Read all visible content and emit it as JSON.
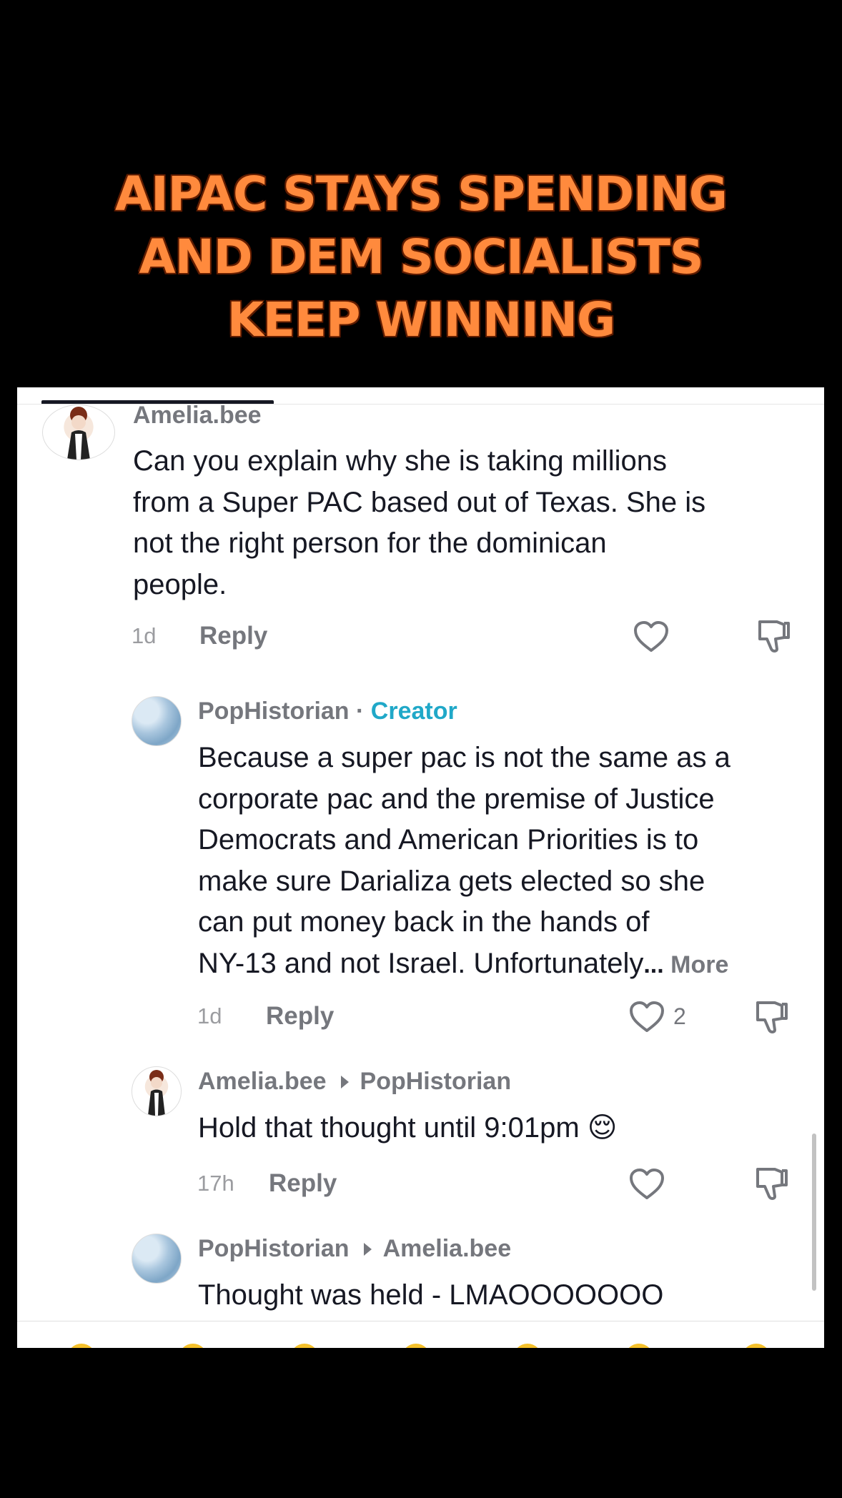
{
  "headline": {
    "line1": "AIPAC STAYS SPENDING",
    "line2": "AND DEM SOCIALISTS",
    "line3": "KEEP WINNING"
  },
  "comments": {
    "c1": {
      "username": "Amelia.bee",
      "lines": [
        "Can you explain why she is taking millions",
        "from a Super PAC based out of Texas. She is",
        "not the right person for the dominican",
        "people."
      ],
      "time": "1d",
      "reply": "Reply"
    },
    "c2": {
      "username": "PopHistorian",
      "separator": " · ",
      "badge": "Creator",
      "lines": [
        "Because a super pac is not the same as a",
        "corporate pac and the premise of Justice",
        "Democrats and American Priorities is to",
        "make sure Darializa gets elected so she",
        "can put money back in the hands of",
        "NY-13 and not Israel. Unfortunately"
      ],
      "ellipsis": "...",
      "more": " More",
      "time": "1d",
      "reply": "Reply",
      "likes": "2"
    },
    "c3": {
      "username": "Amelia.bee",
      "reply_to": "PopHistorian",
      "text": "Hold that thought until 9:01pm 😌",
      "time": "17h",
      "reply": "Reply"
    },
    "c4": {
      "username": "PopHistorian",
      "reply_to": "Amelia.bee",
      "text": "Thought was held - LMAOOOOOOO"
    }
  },
  "icons": {
    "like": "heart-outline-icon",
    "dislike": "thumbs-down-icon",
    "reply_arrow": "triangle-right-icon"
  },
  "colors": {
    "headline": "#ff8a3d",
    "creator_badge": "#20a8c8",
    "text": "#161823",
    "muted": "#75777d"
  }
}
